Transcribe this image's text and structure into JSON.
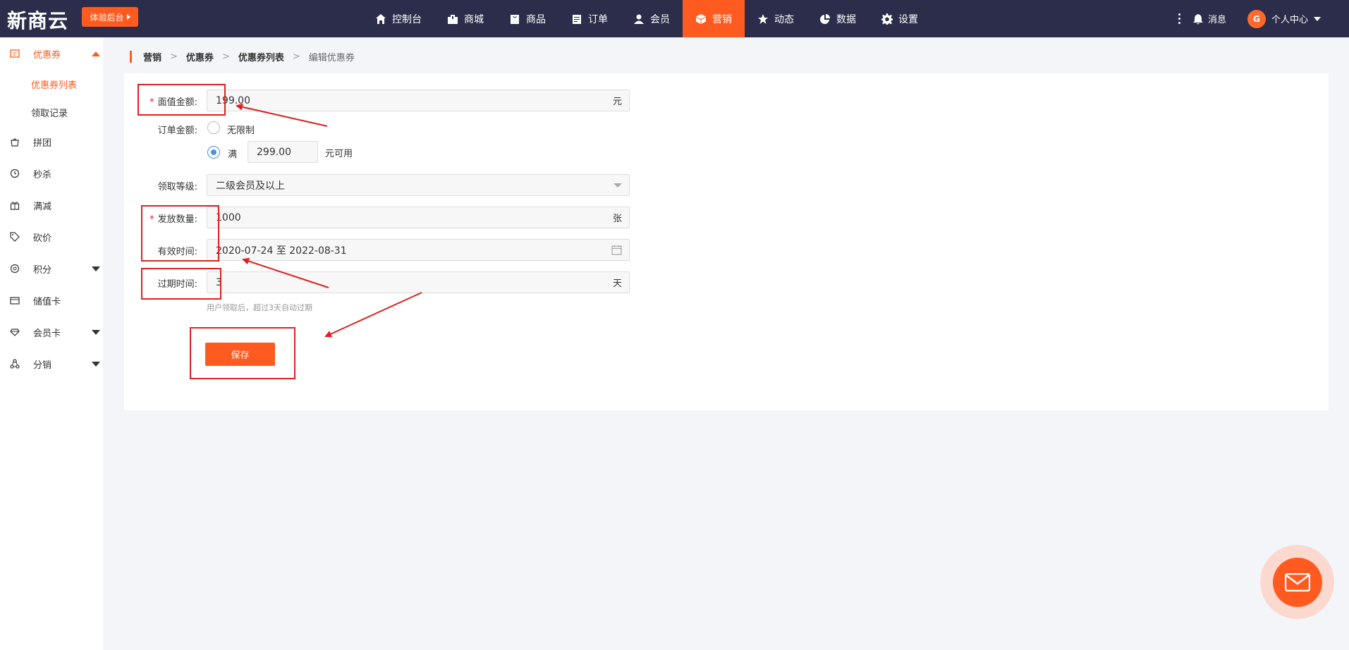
{
  "app": {
    "logo": "新商云",
    "trial_button": "体验后台"
  },
  "nav": {
    "items": [
      {
        "label": "控制台",
        "icon": "home-icon"
      },
      {
        "label": "商城",
        "icon": "store-icon"
      },
      {
        "label": "商品",
        "icon": "bag-icon"
      },
      {
        "label": "订单",
        "icon": "clipboard-icon"
      },
      {
        "label": "会员",
        "icon": "person-icon"
      },
      {
        "label": "营销",
        "icon": "cube-icon",
        "active": true
      },
      {
        "label": "动态",
        "icon": "star-icon"
      },
      {
        "label": "数据",
        "icon": "pie-icon"
      },
      {
        "label": "设置",
        "icon": "gear-icon"
      }
    ],
    "messages": "消息",
    "user": "个人中心",
    "avatar_text": "G"
  },
  "sidebar": {
    "coupon": "优惠券",
    "coupon_list": "优惠券列表",
    "claim_records": "领取记录",
    "group_buy": "拼团",
    "flash_sale": "秒杀",
    "discount": "满减",
    "bargain": "砍价",
    "points": "积分",
    "stored_card": "储值卡",
    "member_card": "会员卡",
    "distribution": "分销"
  },
  "breadcrumb": [
    "营销",
    "优惠券",
    "优惠券列表",
    "编辑优惠券"
  ],
  "form": {
    "face_value_label": "面值金额:",
    "face_value": "199.00",
    "face_value_unit": "元",
    "order_amount_label": "订单金额:",
    "unlimited": "无限制",
    "full": "满",
    "threshold": "299.00",
    "threshold_suffix": "元可用",
    "level_label": "领取等级:",
    "level_value": "二级会员及以上",
    "quantity_label": "发放数量:",
    "quantity": "1000",
    "quantity_unit": "张",
    "valid_time_label": "有效时间:",
    "valid_time": "2020-07-24 至 2022-08-31",
    "expire_label": "过期时间:",
    "expire_days": "3",
    "expire_unit": "天",
    "expire_hint": "用户领取后，超过3天自动过期",
    "save": "保存"
  },
  "colors": {
    "topbar": "#2b2d4a",
    "accent": "#ff5a1f",
    "annotation": "#e02020"
  }
}
